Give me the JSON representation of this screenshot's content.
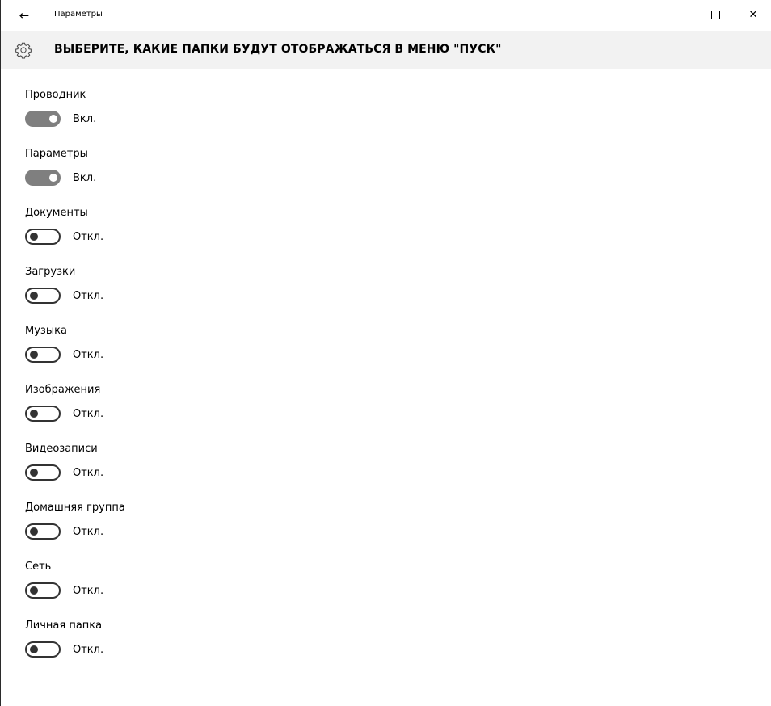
{
  "window": {
    "title": "Параметры",
    "back_icon": "←",
    "caption_buttons": [
      "minimize-icon",
      "maximize-icon",
      "close-icon"
    ],
    "close_glyph": "✕"
  },
  "header": {
    "title": "ВЫБЕРИТЕ, КАКИЕ ПАПКИ БУДУТ ОТОБРАЖАТЬСЯ В МЕНЮ \"ПУСК\"",
    "icon": "gear-icon"
  },
  "settings": [
    {
      "label": "Проводник",
      "state": "on",
      "state_label": "Вкл."
    },
    {
      "label": "Параметры",
      "state": "on",
      "state_label": "Вкл."
    },
    {
      "label": "Документы",
      "state": "off",
      "state_label": "Откл."
    },
    {
      "label": "Загрузки",
      "state": "off",
      "state_label": "Откл."
    },
    {
      "label": "Музыка",
      "state": "off",
      "state_label": "Откл."
    },
    {
      "label": "Изображения",
      "state": "off",
      "state_label": "Откл."
    },
    {
      "label": "Видеозаписи",
      "state": "off",
      "state_label": "Откл."
    },
    {
      "label": "Домашняя группа",
      "state": "off",
      "state_label": "Откл."
    },
    {
      "label": "Сеть",
      "state": "off",
      "state_label": "Откл."
    },
    {
      "label": "Личная папка",
      "state": "off",
      "state_label": "Откл."
    }
  ],
  "colors": {
    "header_bg": "#f2f2f2",
    "toggle_on": "#7f7f7f",
    "toggle_off_border": "#333333"
  }
}
